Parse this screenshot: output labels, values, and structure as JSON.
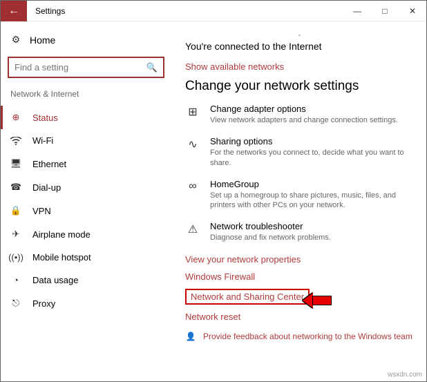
{
  "window": {
    "title": "Settings",
    "controls": {
      "min": "—",
      "max": "□",
      "close": "✕"
    }
  },
  "sidebar": {
    "home": "Home",
    "search_placeholder": "Find a setting",
    "category": "Network & Internet",
    "items": [
      {
        "icon": "status-icon",
        "label": "Status",
        "active": true
      },
      {
        "icon": "wifi-icon",
        "label": "Wi-Fi",
        "active": false
      },
      {
        "icon": "ethernet-icon",
        "label": "Ethernet",
        "active": false
      },
      {
        "icon": "dialup-icon",
        "label": "Dial-up",
        "active": false
      },
      {
        "icon": "vpn-icon",
        "label": "VPN",
        "active": false
      },
      {
        "icon": "airplane-icon",
        "label": "Airplane mode",
        "active": false
      },
      {
        "icon": "hotspot-icon",
        "label": "Mobile hotspot",
        "active": false
      },
      {
        "icon": "data-icon",
        "label": "Data usage",
        "active": false
      },
      {
        "icon": "proxy-icon",
        "label": "Proxy",
        "active": false
      }
    ]
  },
  "main": {
    "status_line": "You're connected to the Internet",
    "show_networks": "Show available networks",
    "section_heading": "Change your network settings",
    "options": [
      {
        "title": "Change adapter options",
        "desc": "View network adapters and change connection settings."
      },
      {
        "title": "Sharing options",
        "desc": "For the networks you connect to, decide what you want to share."
      },
      {
        "title": "HomeGroup",
        "desc": "Set up a homegroup to share pictures, music, files, and printers with other PCs on your network."
      },
      {
        "title": "Network troubleshooter",
        "desc": "Diagnose and fix network problems."
      }
    ],
    "links": {
      "view_props": "View your network properties",
      "firewall": "Windows Firewall",
      "nsc": "Network and Sharing Center",
      "reset": "Network reset"
    },
    "feedback": "Provide feedback about networking to the Windows team"
  },
  "watermark": "wsxdn.com"
}
